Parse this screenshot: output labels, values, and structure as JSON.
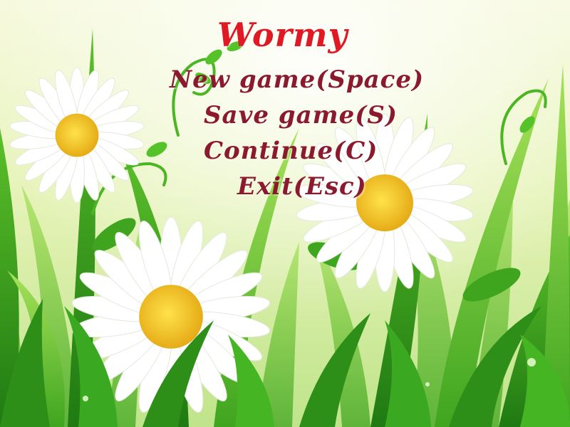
{
  "game": {
    "title": "Wormy",
    "menu": [
      {
        "label": "New game(Space)"
      },
      {
        "label": "Save game(S)"
      },
      {
        "label": "Continue(C)"
      },
      {
        "label": "Exit(Esc)"
      }
    ]
  },
  "colors": {
    "title": "#e01a24",
    "menu_text": "#8b1a2e",
    "sky_top": "#f4f8d2",
    "sky_bottom": "#c9e89a",
    "grass_dark": "#2f9a1c",
    "grass_light": "#7fd33a",
    "petal": "#ffffff",
    "flower_center": "#f2c41a"
  }
}
